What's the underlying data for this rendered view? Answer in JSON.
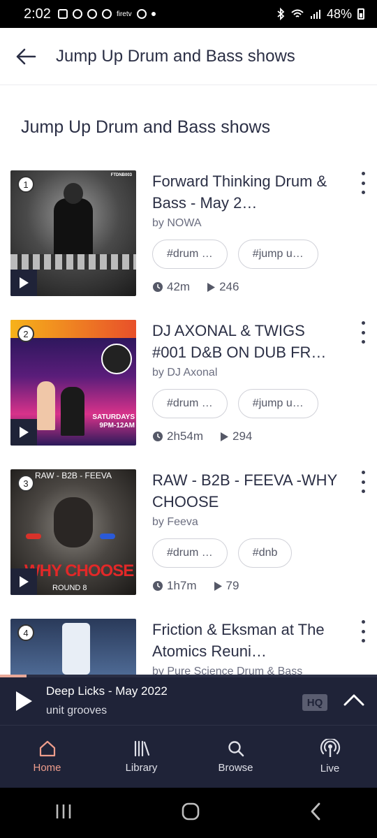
{
  "status_bar": {
    "time": "2:02",
    "battery": "48%"
  },
  "header": {
    "title": "Jump Up Drum and Bass shows"
  },
  "section": {
    "title": "Jump Up Drum and Bass shows"
  },
  "items": [
    {
      "rank": "1",
      "title": "Forward Thinking Drum & Bass - May 2…",
      "by": "by NOWA",
      "tags": [
        "#drum …",
        "#jump u…"
      ],
      "duration": "42m",
      "plays": "246",
      "thumb_text": "FTDNB003"
    },
    {
      "rank": "2",
      "title": "DJ AXONAL & TWIGS #001 D&B ON DUB FR…",
      "by": "by DJ Axonal",
      "tags": [
        "#drum …",
        "#jump u…"
      ],
      "duration": "2h54m",
      "plays": "294",
      "thumb_text": "SATURDAYS 9PM-12AM"
    },
    {
      "rank": "3",
      "title": "RAW - B2B - FEEVA -WHY CHOOSE",
      "by": "by Feeva",
      "tags": [
        "#drum …",
        "#dnb"
      ],
      "duration": "1h7m",
      "plays": "79",
      "thumb_text": "RAW - B2B - FEEVA",
      "thumb_text2": "WHY CHOOSE",
      "thumb_text3": "ROUND 8"
    },
    {
      "rank": "4",
      "title": "Friction & Eksman at The Atomics Reuni…",
      "by": "by Pure Science Drum & Bass"
    }
  ],
  "mini_player": {
    "title": "Deep Licks - May 2022",
    "artist": "unit grooves",
    "hq_label": "HQ",
    "progress": 0.07
  },
  "bottom_nav": [
    {
      "label": "Home",
      "icon": "home-icon",
      "active": true
    },
    {
      "label": "Library",
      "icon": "library-icon"
    },
    {
      "label": "Browse",
      "icon": "search-icon"
    },
    {
      "label": "Live",
      "icon": "live-icon"
    }
  ],
  "colors": {
    "accent": "#ee9d8c",
    "dark_bar": "#1f2338",
    "text": "#2b2f45"
  }
}
